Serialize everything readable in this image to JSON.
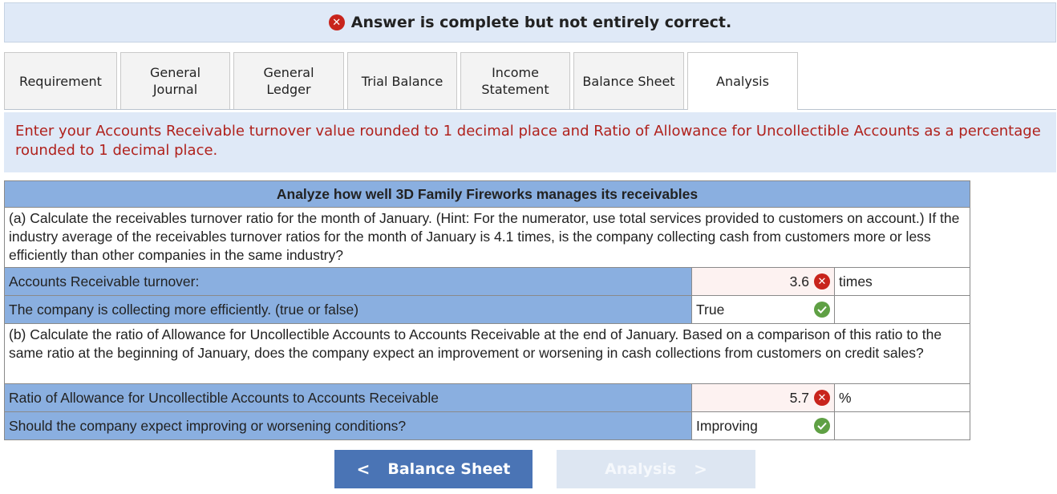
{
  "banner": {
    "text": "Answer is complete but not entirely correct.",
    "icon": "x-icon"
  },
  "tabs": [
    {
      "label": "Requirement"
    },
    {
      "label": "General Journal"
    },
    {
      "label": "General Ledger"
    },
    {
      "label": "Trial Balance"
    },
    {
      "label": "Income Statement"
    },
    {
      "label": "Balance Sheet"
    },
    {
      "label": "Analysis"
    }
  ],
  "active_tab": "Analysis",
  "instruction": "Enter your Accounts Receivable turnover value rounded to 1 decimal place and Ratio of Allowance for Uncollectible Accounts as a percentage rounded to 1 decimal place.",
  "table": {
    "title": "Analyze how well 3D Family Fireworks manages its receivables",
    "question_a": "(a) Calculate the receivables turnover ratio for the month of January. (Hint: For the numerator, use total services provided to customers on account.) If the industry average of the receivables turnover ratios for the month of January is 4.1 times, is the company collecting cash from customers more or less efficiently than other companies in the same industry?",
    "rows_a": [
      {
        "label": "Accounts Receivable turnover:",
        "value": "3.6",
        "status": "incorrect",
        "unit": "times"
      },
      {
        "label": "The company is collecting more efficiently. (true or false)",
        "value": "True",
        "status": "correct",
        "unit": ""
      }
    ],
    "question_b": "(b) Calculate the ratio of Allowance for Uncollectible Accounts to Accounts Receivable at the end of January. Based on a comparison of this ratio to the same ratio at the beginning of January, does the company expect an improvement or worsening in cash collections from customers on credit sales?",
    "rows_b": [
      {
        "label": "Ratio of Allowance for Uncollectible Accounts to Accounts Receivable",
        "value": "5.7",
        "status": "incorrect",
        "unit": "%"
      },
      {
        "label": "Should the company expect improving or worsening conditions?",
        "value": "Improving",
        "status": "correct",
        "unit": ""
      }
    ]
  },
  "nav": {
    "prev_label": "Balance Sheet",
    "next_label": "Analysis",
    "next_disabled": true
  },
  "colors": {
    "accent": "#4a74b5",
    "header_blue": "#8aafe0",
    "banner_bg": "#dfe9f7",
    "error_red": "#c8241c",
    "success_green": "#5fa044",
    "instruction_red": "#b0211c"
  }
}
